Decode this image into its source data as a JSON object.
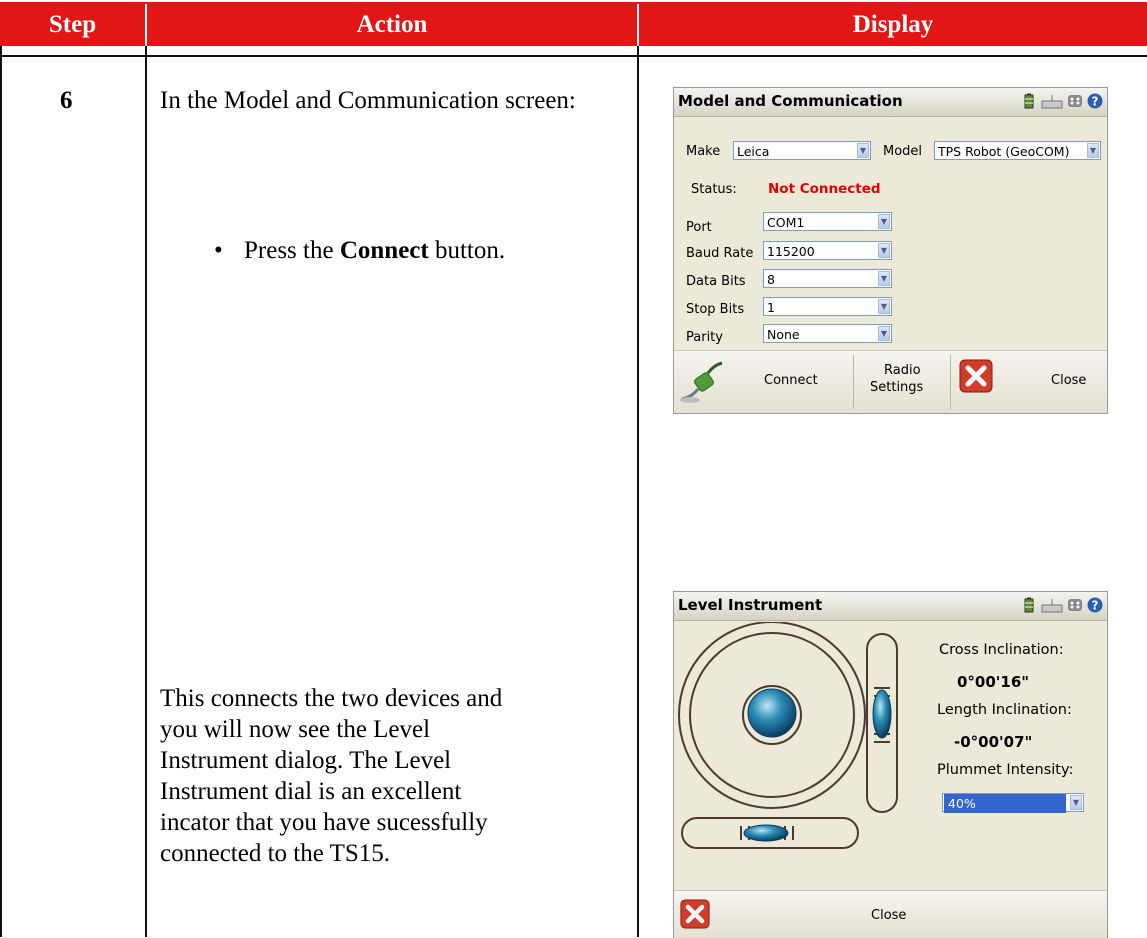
{
  "header": {
    "step": "Step",
    "action": "Action",
    "display": "Display"
  },
  "row": {
    "step_number": "6",
    "instruction": "In the Model and Communication screen:",
    "bullet_prefix": "Press the ",
    "bullet_bold": "Connect",
    "bullet_suffix": " button.",
    "explanation_lines": [
      "This connects the two devices and",
      "you will now see the Level",
      "Instrument dialog.  The Level",
      "Instrument dial is an excellent",
      "incator that you have sucessfully",
      "connected to the TS15."
    ]
  },
  "model_dialog": {
    "title": "Model and Communication",
    "make_label": "Make",
    "make_value": "Leica",
    "model_label": "Model",
    "model_value": "TPS Robot (GeoCOM)",
    "status_label": "Status:",
    "status_value": "Not Connected",
    "status_color": "#e00000",
    "fields": [
      {
        "label": "Port",
        "value": "COM1"
      },
      {
        "label": "Baud Rate",
        "value": "115200"
      },
      {
        "label": "Data Bits",
        "value": "8"
      },
      {
        "label": "Stop Bits",
        "value": "1"
      },
      {
        "label": "Parity",
        "value": "None"
      }
    ],
    "connect_label": "Connect",
    "radio_label_1": "Radio",
    "radio_label_2": "Settings",
    "close_label": "Close"
  },
  "level_dialog": {
    "title": "Level Instrument",
    "cross_label": "Cross Inclination:",
    "cross_value": "0°00'16\"",
    "length_label": "Length Inclination:",
    "length_value": "-0°00'07\"",
    "plummet_label": "Plummet Intensity:",
    "plummet_value": "40%",
    "close_label": "Close"
  },
  "icons": [
    "battery-icon",
    "keyboard-icon",
    "settings-icon",
    "help-icon",
    "connect-plug-icon",
    "close-x-icon",
    "bubble-icon"
  ]
}
